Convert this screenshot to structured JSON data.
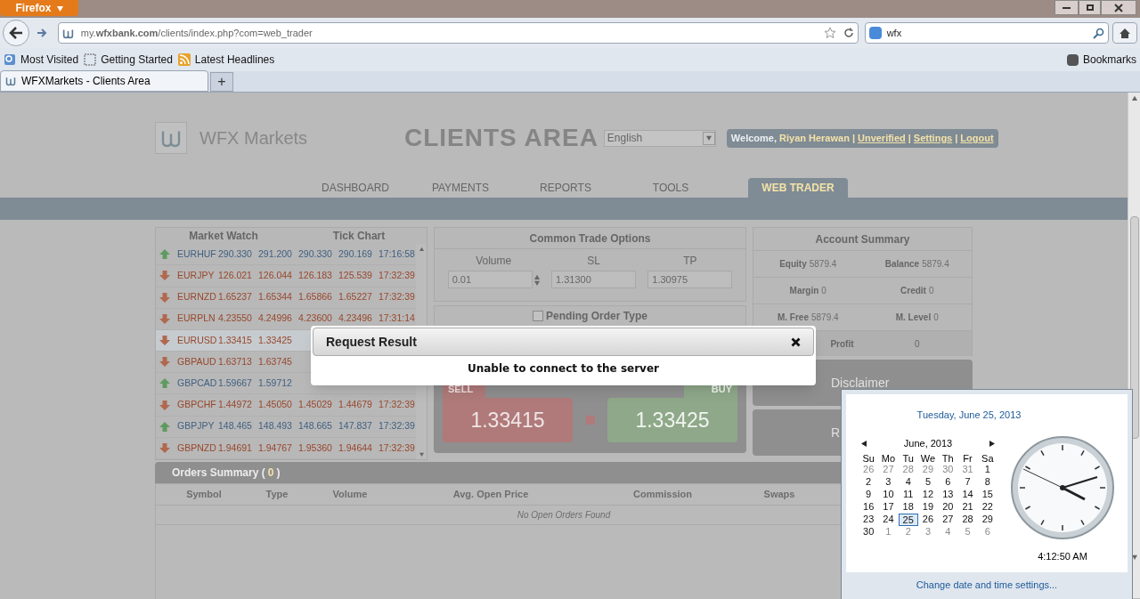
{
  "browser": {
    "app_button": "Firefox",
    "url": "my.**wfxbank.com**/clients/index.php?com=web_trader",
    "search": "wfx",
    "bookmarks": [
      {
        "label": "Most Visited",
        "kind": "smart"
      },
      {
        "label": "Getting Started",
        "kind": "page"
      },
      {
        "label": "Latest Headlines",
        "kind": "feed"
      }
    ],
    "bookmarks_menu": "Bookmarks",
    "tabs": [
      {
        "label": "WFXMarkets - Clients Area",
        "selected": true
      }
    ],
    "new_tab": "+"
  },
  "header": {
    "logo": "WFX Markets",
    "title": "CLIENTS AREA",
    "language": "English",
    "welcome": "Welcome,",
    "user": "Riyan Herawan",
    "separator": "|",
    "links": [
      "Unverified",
      "Settings",
      "Logout"
    ]
  },
  "nav": [
    {
      "label": "DASHBOARD",
      "selected": false
    },
    {
      "label": "PAYMENTS",
      "selected": false
    },
    {
      "label": "REPORTS",
      "selected": false
    },
    {
      "label": "TOOLS",
      "selected": false
    },
    {
      "label": "WEB TRADER",
      "selected": true
    }
  ],
  "market": {
    "tabs": [
      "Market Watch",
      "Tick Chart"
    ],
    "rows": [
      {
        "symbol": "EURHUF",
        "bid": "290.330",
        "ask": "291.200",
        "high": "290.330",
        "low": "290.169",
        "time": "17:16:58",
        "kind": "up",
        "selected": false
      },
      {
        "symbol": "EURJPY",
        "bid": "126.021",
        "ask": "126.044",
        "high": "126.183",
        "low": "125.539",
        "time": "17:32:39",
        "kind": "down",
        "selected": false
      },
      {
        "symbol": "EURNZD",
        "bid": "1.65237",
        "ask": "1.65344",
        "high": "1.65866",
        "low": "1.65227",
        "time": "17:32:39",
        "kind": "down",
        "selected": false
      },
      {
        "symbol": "EURPLN",
        "bid": "4.23550",
        "ask": "4.24996",
        "high": "4.23600",
        "low": "4.23496",
        "time": "17:31:14",
        "kind": "down",
        "selected": false
      },
      {
        "symbol": "EURUSD",
        "bid": "1.33415",
        "ask": "1.33425",
        "kind": "down",
        "selected": true
      },
      {
        "symbol": "GBPAUD",
        "bid": "1.63713",
        "ask": "1.63745",
        "kind": "down",
        "selected": false
      },
      {
        "symbol": "GBPCAD",
        "bid": "1.59667",
        "ask": "1.59712",
        "kind": "up",
        "selected": false
      },
      {
        "symbol": "GBPCHF",
        "bid": "1.44972",
        "ask": "1.45050",
        "high": "1.45029",
        "low": "1.44679",
        "time": "17:32:39",
        "kind": "down",
        "selected": false
      },
      {
        "symbol": "GBPJPY",
        "bid": "148.465",
        "ask": "148.493",
        "high": "148.665",
        "low": "147.837",
        "time": "17:32:39",
        "kind": "up",
        "selected": false
      },
      {
        "symbol": "GBPNZD",
        "bid": "1.94691",
        "ask": "1.94767",
        "high": "1.95360",
        "low": "1.94644",
        "time": "17:32:39",
        "kind": "down",
        "selected": false
      }
    ]
  },
  "trade": {
    "title": "Common Trade Options",
    "fields": [
      {
        "label": "Volume",
        "value": "0.01",
        "kind": "spinner"
      },
      {
        "label": "SL",
        "value": "1.31300",
        "kind": "text"
      },
      {
        "label": "TP",
        "value": "1.30975",
        "kind": "text"
      }
    ],
    "pending": {
      "label": "Pending Order Type",
      "checked": false
    },
    "sell": {
      "label": "SELL",
      "price": "1.33415"
    },
    "buy": {
      "label": "BUY",
      "price": "1.33425"
    }
  },
  "account": {
    "title": "Account Summary",
    "items": [
      {
        "label": "Equity",
        "value": "5879.4"
      },
      {
        "label": "Balance",
        "value": "5879.4"
      },
      {
        "label": "Margin",
        "value": "0"
      },
      {
        "label": "Credit",
        "value": "0"
      },
      {
        "label": "M. Free",
        "value": "5879.4"
      },
      {
        "label": "M. Level",
        "value": "0"
      }
    ],
    "profit": {
      "label": "Profit",
      "value": "0"
    },
    "buttons": [
      "Disclaimer",
      "R"
    ]
  },
  "orders": {
    "title": "Orders Summary (",
    "count": "0",
    "close": ")",
    "columns": [
      "Symbol",
      "Type",
      "Volume",
      "Avg. Open Price",
      "Commission",
      "Swaps"
    ],
    "empty": "No Open Orders Found"
  },
  "dialog": {
    "title": "Request Result",
    "message": "Unable to connect to the server"
  },
  "calendar": {
    "date": "Tuesday, June 25, 2013",
    "month": "June, 2013",
    "weekdays": [
      "Su",
      "Mo",
      "Tu",
      "We",
      "Th",
      "Fr",
      "Sa"
    ],
    "weeks": [
      [
        {
          "d": "26",
          "other": true,
          "selected": false
        },
        {
          "d": "27",
          "other": true,
          "selected": false
        },
        {
          "d": "28",
          "other": true,
          "selected": false
        },
        {
          "d": "29",
          "other": true,
          "selected": false
        },
        {
          "d": "30",
          "other": true,
          "selected": false
        },
        {
          "d": "31",
          "other": true,
          "selected": false
        },
        {
          "d": "1",
          "other": false,
          "selected": false
        }
      ],
      [
        {
          "d": "2",
          "other": false,
          "selected": false
        },
        {
          "d": "3",
          "other": false,
          "selected": false
        },
        {
          "d": "4",
          "other": false,
          "selected": false
        },
        {
          "d": "5",
          "other": false,
          "selected": false
        },
        {
          "d": "6",
          "other": false,
          "selected": false
        },
        {
          "d": "7",
          "other": false,
          "selected": false
        },
        {
          "d": "8",
          "other": false,
          "selected": false
        }
      ],
      [
        {
          "d": "9",
          "other": false,
          "selected": false
        },
        {
          "d": "10",
          "other": false,
          "selected": false
        },
        {
          "d": "11",
          "other": false,
          "selected": false
        },
        {
          "d": "12",
          "other": false,
          "selected": false
        },
        {
          "d": "13",
          "other": false,
          "selected": false
        },
        {
          "d": "14",
          "other": false,
          "selected": false
        },
        {
          "d": "15",
          "other": false,
          "selected": false
        }
      ],
      [
        {
          "d": "16",
          "other": false,
          "selected": false
        },
        {
          "d": "17",
          "other": false,
          "selected": false
        },
        {
          "d": "18",
          "other": false,
          "selected": false
        },
        {
          "d": "19",
          "other": false,
          "selected": false
        },
        {
          "d": "20",
          "other": false,
          "selected": false
        },
        {
          "d": "21",
          "other": false,
          "selected": false
        },
        {
          "d": "22",
          "other": false,
          "selected": false
        }
      ],
      [
        {
          "d": "23",
          "other": false,
          "selected": false
        },
        {
          "d": "24",
          "other": false,
          "selected": false
        },
        {
          "d": "25",
          "other": false,
          "selected": true
        },
        {
          "d": "26",
          "other": false,
          "selected": false
        },
        {
          "d": "27",
          "other": false,
          "selected": false
        },
        {
          "d": "28",
          "other": false,
          "selected": false
        },
        {
          "d": "29",
          "other": false,
          "selected": false
        }
      ],
      [
        {
          "d": "30",
          "other": false,
          "selected": false
        },
        {
          "d": "1",
          "other": true,
          "selected": false
        },
        {
          "d": "2",
          "other": true,
          "selected": false
        },
        {
          "d": "3",
          "other": true,
          "selected": false
        },
        {
          "d": "4",
          "other": true,
          "selected": false
        },
        {
          "d": "5",
          "other": true,
          "selected": false
        },
        {
          "d": "6",
          "other": true,
          "selected": false
        }
      ]
    ],
    "time": "4:12:50 AM",
    "link": "Change date and time settings..."
  }
}
